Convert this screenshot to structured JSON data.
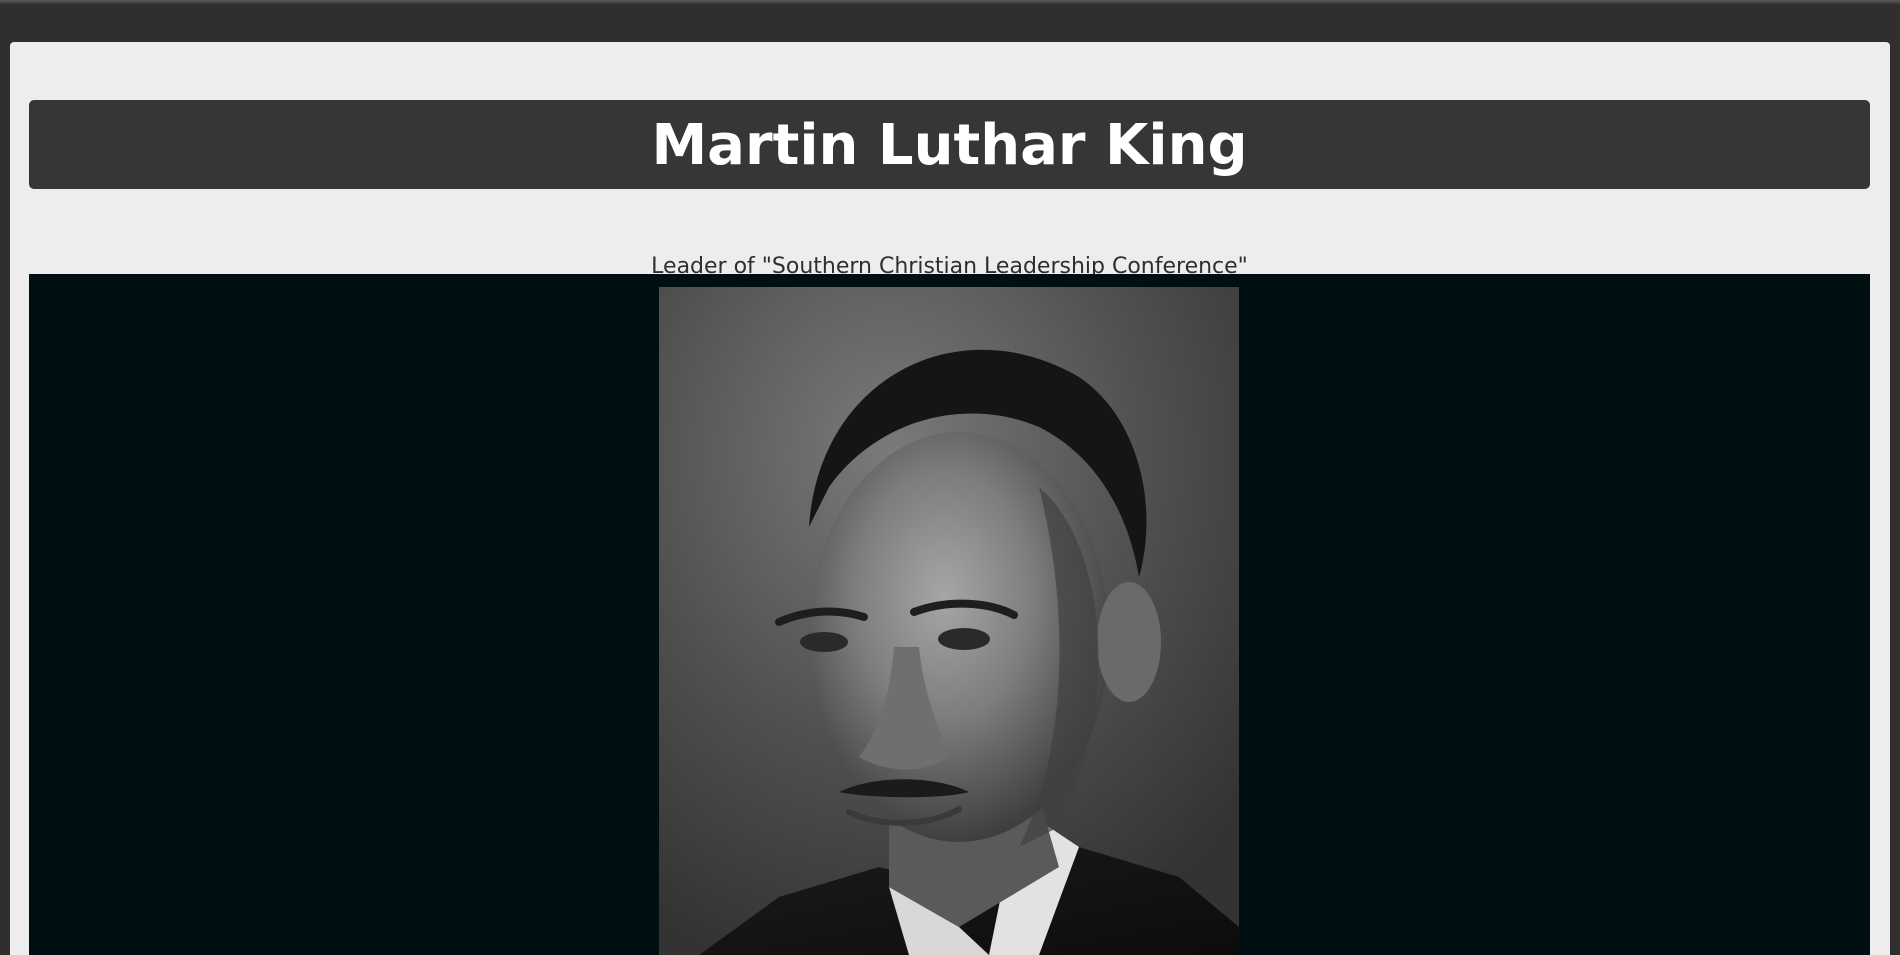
{
  "page": {
    "title": "Martin Luthar King",
    "subtitle": "Leader of \"Southern Christian Leadership Conference\""
  },
  "image": {
    "description_name": "portrait-photo",
    "stage_color": "#001012",
    "banner_color": "#363636",
    "page_bg": "#ededed",
    "frame_color": "#2f2f2f"
  }
}
